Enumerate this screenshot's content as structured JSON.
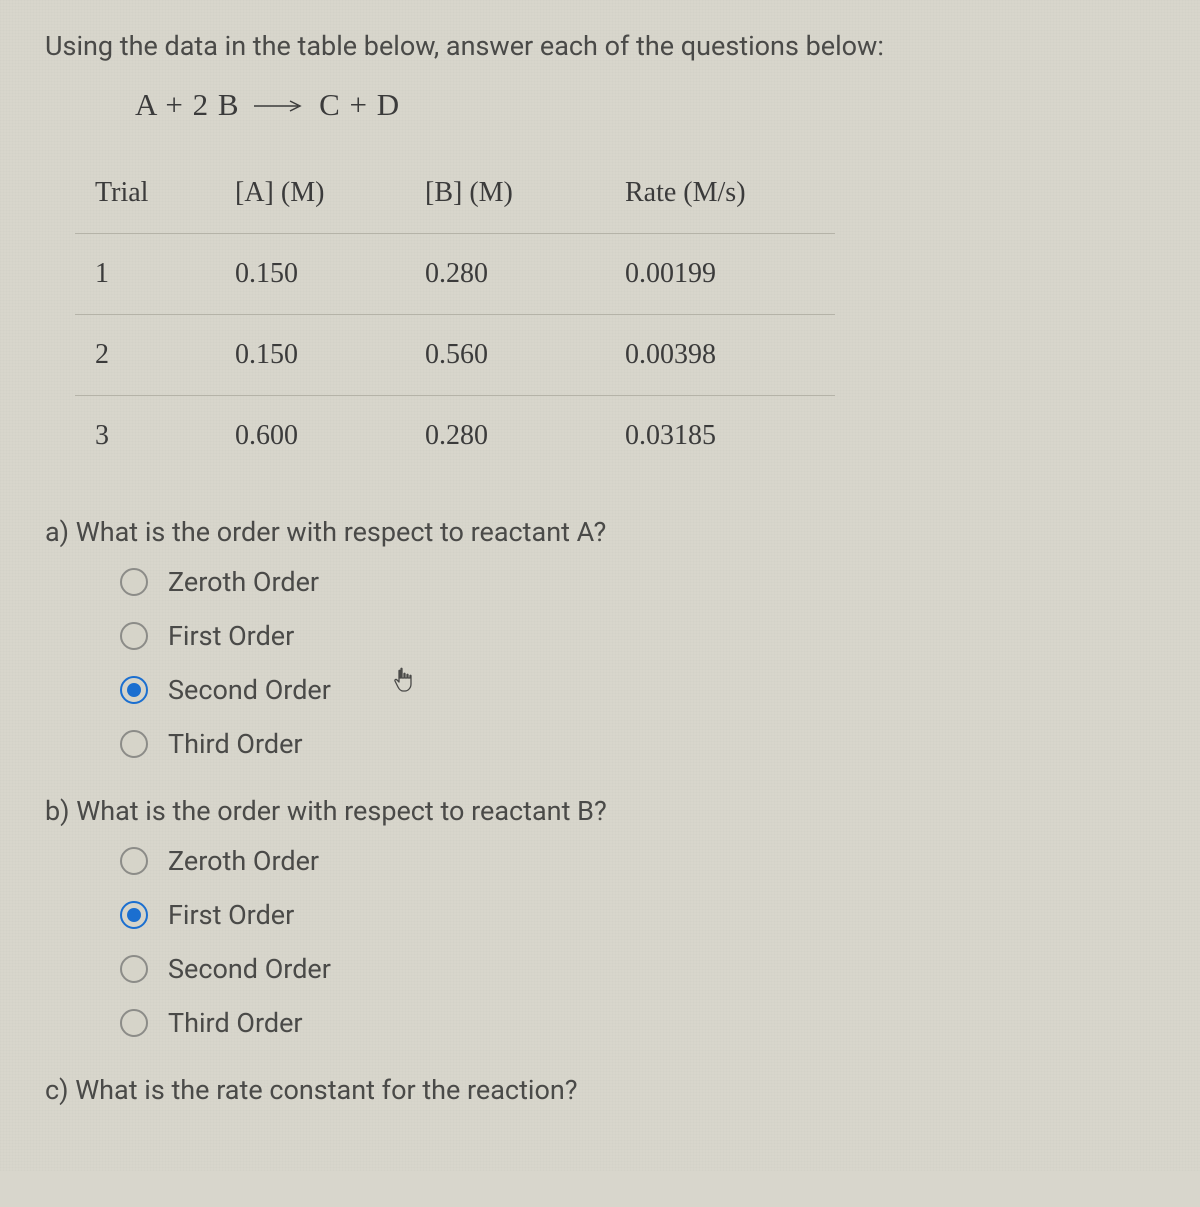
{
  "intro": "Using the data in the table below, answer each of the questions below:",
  "equation": {
    "lhs": "A + 2 B",
    "rhs": "C + D"
  },
  "table": {
    "headers": [
      "Trial",
      "[A] (M)",
      "[B] (M)",
      "Rate (M/s)"
    ],
    "rows": [
      [
        "1",
        "0.150",
        "0.280",
        "0.00199"
      ],
      [
        "2",
        "0.150",
        "0.560",
        "0.00398"
      ],
      [
        "3",
        "0.600",
        "0.280",
        "0.03185"
      ]
    ]
  },
  "questions": {
    "a": {
      "text": "a) What is the order with respect to reactant A?",
      "options": [
        "Zeroth Order",
        "First Order",
        "Second Order",
        "Third Order"
      ],
      "selected": 2
    },
    "b": {
      "text": "b) What is the order with respect to reactant B?",
      "options": [
        "Zeroth Order",
        "First Order",
        "Second Order",
        "Third Order"
      ],
      "selected": 1
    },
    "c": {
      "text": "c) What is the rate constant for the reaction?"
    }
  }
}
